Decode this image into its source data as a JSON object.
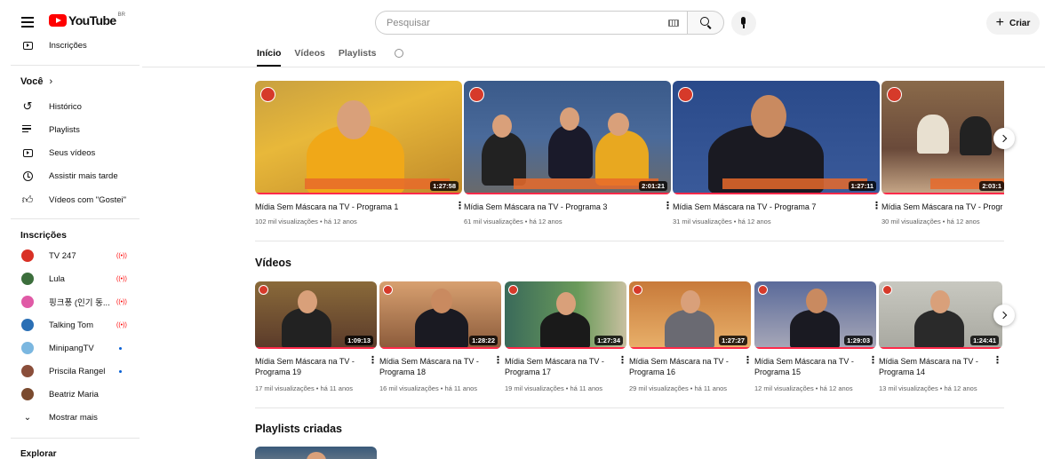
{
  "header": {
    "logo_text": "YouTube",
    "logo_region": "BR",
    "search_placeholder": "Pesquisar",
    "create_label": "Criar"
  },
  "sidebar": {
    "top_item": "Inscrições",
    "you_heading": "Você",
    "you_items": [
      "Histórico",
      "Playlists",
      "Seus vídeos",
      "Assistir mais tarde",
      "Vídeos com \"Gostei\""
    ],
    "subs_heading": "Inscrições",
    "subscriptions": [
      {
        "name": "TV 247",
        "status": "live",
        "color": "#d93025"
      },
      {
        "name": "Lula",
        "status": "live",
        "color": "#3c6e3c"
      },
      {
        "name": "핑크퐁 (인기 동...",
        "status": "live",
        "color": "#e05aa6"
      },
      {
        "name": "Talking Tom",
        "status": "live",
        "color": "#2a6fb5"
      },
      {
        "name": "MinipangTV",
        "status": "new",
        "color": "#7bb7e0"
      },
      {
        "name": "Priscila Rangel",
        "status": "new",
        "color": "#8a4e3a"
      },
      {
        "name": "Beatriz Maria",
        "status": "",
        "color": "#7a4a2e"
      }
    ],
    "show_more": "Mostrar mais",
    "explore_heading": "Explorar"
  },
  "tabs": [
    "Início",
    "Vídeos",
    "Playlists"
  ],
  "featured": [
    {
      "title": "Mídia Sem Máscara na TV - Programa 1",
      "meta": "102 mil visualizações • há 12 anos",
      "duration": "1:27:58"
    },
    {
      "title": "Mídia Sem Máscara na TV - Programa 3",
      "meta": "61 mil visualizações • há 12 anos",
      "duration": "2:01:21"
    },
    {
      "title": "Mídia Sem Máscara na TV - Programa 7",
      "meta": "31 mil visualizações • há 12 anos",
      "duration": "1:27:11"
    },
    {
      "title": "Mídia Sem Máscara na TV - Progr",
      "meta": "30 mil visualizações • há 12 anos",
      "duration": "2:03:1"
    }
  ],
  "videos_section": {
    "title": "Vídeos",
    "items": [
      {
        "title1": "Mídia Sem Máscara na TV -",
        "title2": "Programa 19",
        "meta": "17 mil visualizações • há 11 anos",
        "duration": "1:09:13"
      },
      {
        "title1": "Mídia Sem Máscara na TV -",
        "title2": "Programa 18",
        "meta": "16 mil visualizações • há 11 anos",
        "duration": "1:28:22"
      },
      {
        "title1": "Mídia Sem Máscara na TV -",
        "title2": "Programa 17",
        "meta": "19 mil visualizações • há 11 anos",
        "duration": "1:27:34"
      },
      {
        "title1": "Mídia Sem Máscara na TV -",
        "title2": "Programa 16",
        "meta": "29 mil visualizações • há 11 anos",
        "duration": "1:27:27"
      },
      {
        "title1": "Mídia Sem Máscara na TV -",
        "title2": "Programa 15",
        "meta": "12 mil visualizações • há 12 anos",
        "duration": "1:29:03"
      },
      {
        "title1": "Mídia Sem Máscara na TV -",
        "title2": "Programa 14",
        "meta": "13 mil visualizações • há 12 anos",
        "duration": "1:24:41"
      }
    ]
  },
  "playlists_section": {
    "title": "Playlists criadas"
  },
  "colors": {
    "accent_red": "#ff0000",
    "progress": "#ff2a4a",
    "meta_gray": "#606060"
  }
}
